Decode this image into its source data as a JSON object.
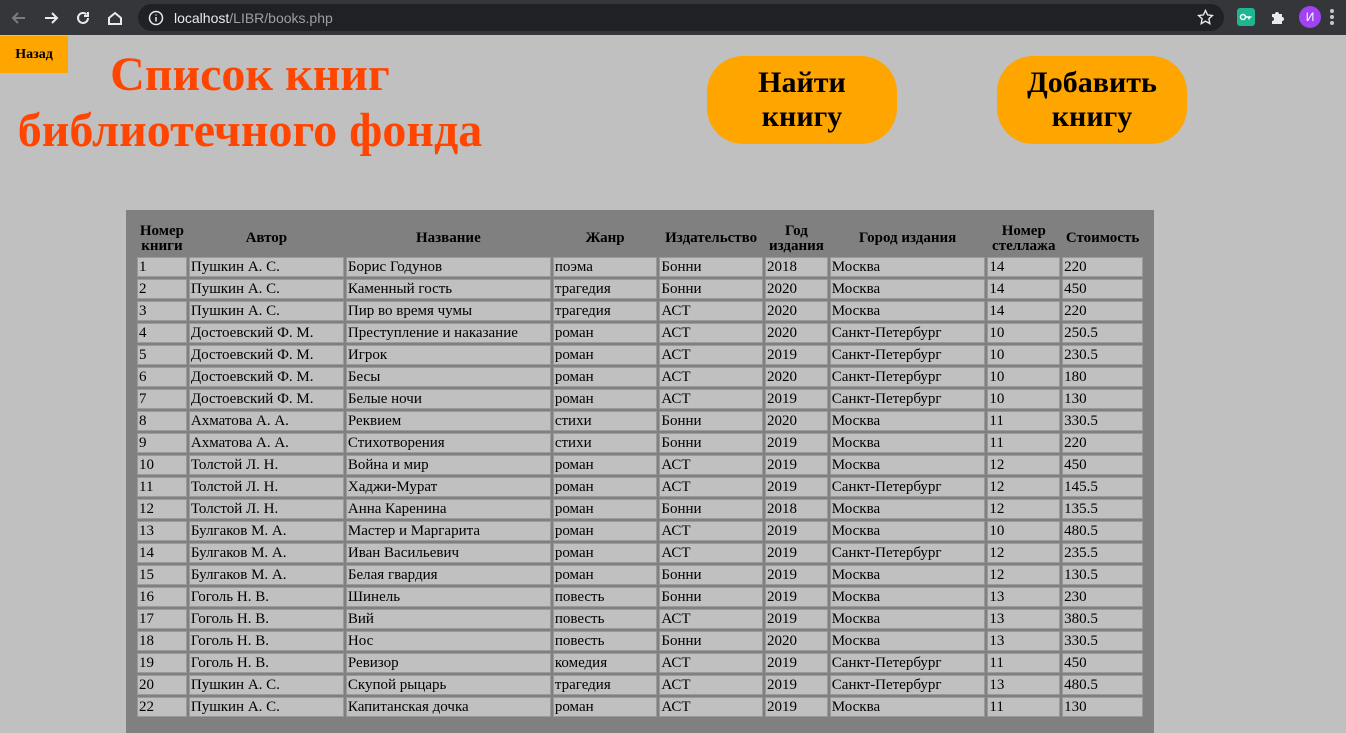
{
  "browser": {
    "url_host": "localhost",
    "url_path": "/LIBR/books.php",
    "avatar_letter": "И"
  },
  "page": {
    "back_label": "Назад",
    "title_line1": "Список книг",
    "title_line2": "библиотечного фонда",
    "find_line1": "Найти",
    "find_line2": "книгу",
    "add_line1": "Добавить",
    "add_line2": "книгу"
  },
  "colors": {
    "accent": "#ffa500",
    "title": "#ff4500",
    "background": "#c0c0c0",
    "table_bg": "#808080"
  },
  "table": {
    "headers": [
      [
        "Номер",
        "книги"
      ],
      [
        "Автор",
        ""
      ],
      [
        "Название",
        ""
      ],
      [
        "Жанр",
        ""
      ],
      [
        "Издательство",
        ""
      ],
      [
        "Год",
        "издания"
      ],
      [
        "Город издания",
        ""
      ],
      [
        "Номер",
        "стеллажа"
      ],
      [
        "Стоимость",
        ""
      ]
    ],
    "rows": [
      [
        "1",
        "Пушкин А. С.",
        "Борис Годунов",
        "поэма",
        "Бонни",
        "2018",
        "Москва",
        "14",
        "220"
      ],
      [
        "2",
        "Пушкин А. С.",
        "Каменный гость",
        "трагедия",
        "Бонни",
        "2020",
        "Москва",
        "14",
        "450"
      ],
      [
        "3",
        "Пушкин А. С.",
        "Пир во время чумы",
        "трагедия",
        "АСТ",
        "2020",
        "Москва",
        "14",
        "220"
      ],
      [
        "4",
        "Достоевский Ф. М.",
        "Преступление и наказание",
        "роман",
        "АСТ",
        "2020",
        "Санкт-Петербург",
        "10",
        "250.5"
      ],
      [
        "5",
        "Достоевский Ф. М.",
        "Игрок",
        "роман",
        "АСТ",
        "2019",
        "Санкт-Петербург",
        "10",
        "230.5"
      ],
      [
        "6",
        "Достоевский Ф. М.",
        "Бесы",
        "роман",
        "АСТ",
        "2020",
        "Санкт-Петербург",
        "10",
        "180"
      ],
      [
        "7",
        "Достоевский Ф. М.",
        "Белые ночи",
        "роман",
        "АСТ",
        "2019",
        "Санкт-Петербург",
        "10",
        "130"
      ],
      [
        "8",
        "Ахматова А. А.",
        "Реквием",
        "стихи",
        "Бонни",
        "2020",
        "Москва",
        "11",
        "330.5"
      ],
      [
        "9",
        "Ахматова А. А.",
        "Стихотворения",
        "стихи",
        "Бонни",
        "2019",
        "Москва",
        "11",
        "220"
      ],
      [
        "10",
        "Толстой Л. Н.",
        "Война и мир",
        "роман",
        "АСТ",
        "2019",
        "Москва",
        "12",
        "450"
      ],
      [
        "11",
        "Толстой Л. Н.",
        "Хаджи-Мурат",
        "роман",
        "АСТ",
        "2019",
        "Санкт-Петербург",
        "12",
        "145.5"
      ],
      [
        "12",
        "Толстой Л. Н.",
        "Анна Каренина",
        "роман",
        "Бонни",
        "2018",
        "Москва",
        "12",
        "135.5"
      ],
      [
        "13",
        "Булгаков М. А.",
        "Мастер и Маргарита",
        "роман",
        "АСТ",
        "2019",
        "Москва",
        "10",
        "480.5"
      ],
      [
        "14",
        "Булгаков М. А.",
        "Иван Васильевич",
        "роман",
        "АСТ",
        "2019",
        "Санкт-Петербург",
        "12",
        "235.5"
      ],
      [
        "15",
        "Булгаков М. А.",
        "Белая гвардия",
        "роман",
        "Бонни",
        "2019",
        "Москва",
        "12",
        "130.5"
      ],
      [
        "16",
        "Гоголь Н. В.",
        "Шинель",
        "повесть",
        "Бонни",
        "2019",
        "Москва",
        "13",
        "230"
      ],
      [
        "17",
        "Гоголь Н. В.",
        "Вий",
        "повесть",
        "АСТ",
        "2019",
        "Москва",
        "13",
        "380.5"
      ],
      [
        "18",
        "Гоголь Н. В.",
        "Нос",
        "повесть",
        "Бонни",
        "2020",
        "Москва",
        "13",
        "330.5"
      ],
      [
        "19",
        "Гоголь Н. В.",
        "Ревизор",
        "комедия",
        "АСТ",
        "2019",
        "Санкт-Петербург",
        "11",
        "450"
      ],
      [
        "20",
        "Пушкин А. С.",
        "Скупой рыцарь",
        "трагедия",
        "АСТ",
        "2019",
        "Санкт-Петербург",
        "13",
        "480.5"
      ],
      [
        "22",
        "Пушкин А. С.",
        "Капитанская дочка",
        "роман",
        "АСТ",
        "2019",
        "Москва",
        "11",
        "130"
      ]
    ]
  }
}
